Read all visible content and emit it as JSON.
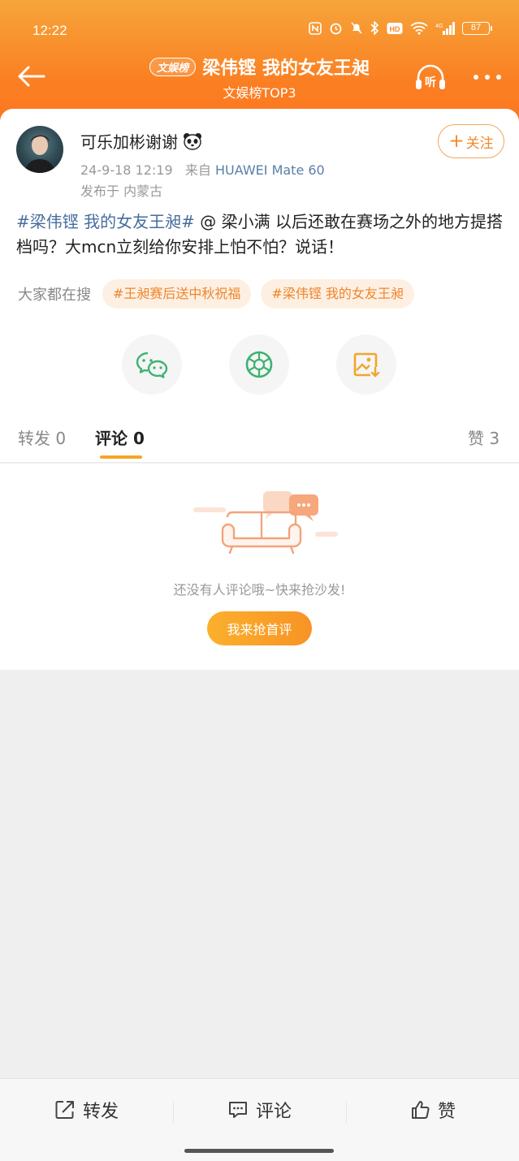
{
  "status_bar": {
    "time": "12:22",
    "battery": "87"
  },
  "nav": {
    "tag": "文娱榜",
    "title": "梁伟铿 我的女友王昶",
    "subtitle": "文娱榜TOP3",
    "listen_label": "听"
  },
  "post": {
    "username": "可乐加彬谢谢",
    "date": "24-9-18 12:19",
    "from_prefix": "来自",
    "device": "HUAWEI Mate 60",
    "location": "发布于 内蒙古",
    "follow_label": "关注",
    "topic": "#梁伟铿 我的女友王昶#",
    "body": " @ 梁小满 以后还敢在赛场之外的地方提搭档吗？大mcn立刻给你安排上怕不怕？说话！"
  },
  "search": {
    "label": "大家都在搜",
    "chips": [
      "#王昶赛后送中秋祝福",
      "#梁伟铿 我的女友王昶"
    ]
  },
  "share": {
    "icons": [
      "wechat-icon",
      "moments-icon",
      "save-image-icon"
    ]
  },
  "tabs": {
    "repost": "转发 0",
    "comment": "评论 0",
    "like": "赞 3"
  },
  "empty": {
    "text": "还没有人评论哦~快来抢沙发!",
    "button": "我来抢首评"
  },
  "bottom_bar": {
    "repost": "转发",
    "comment": "评论",
    "like": "赞"
  },
  "colors": {
    "accent": "#fb7f22",
    "topic": "#466d9e",
    "chip_text": "#f0852a"
  }
}
